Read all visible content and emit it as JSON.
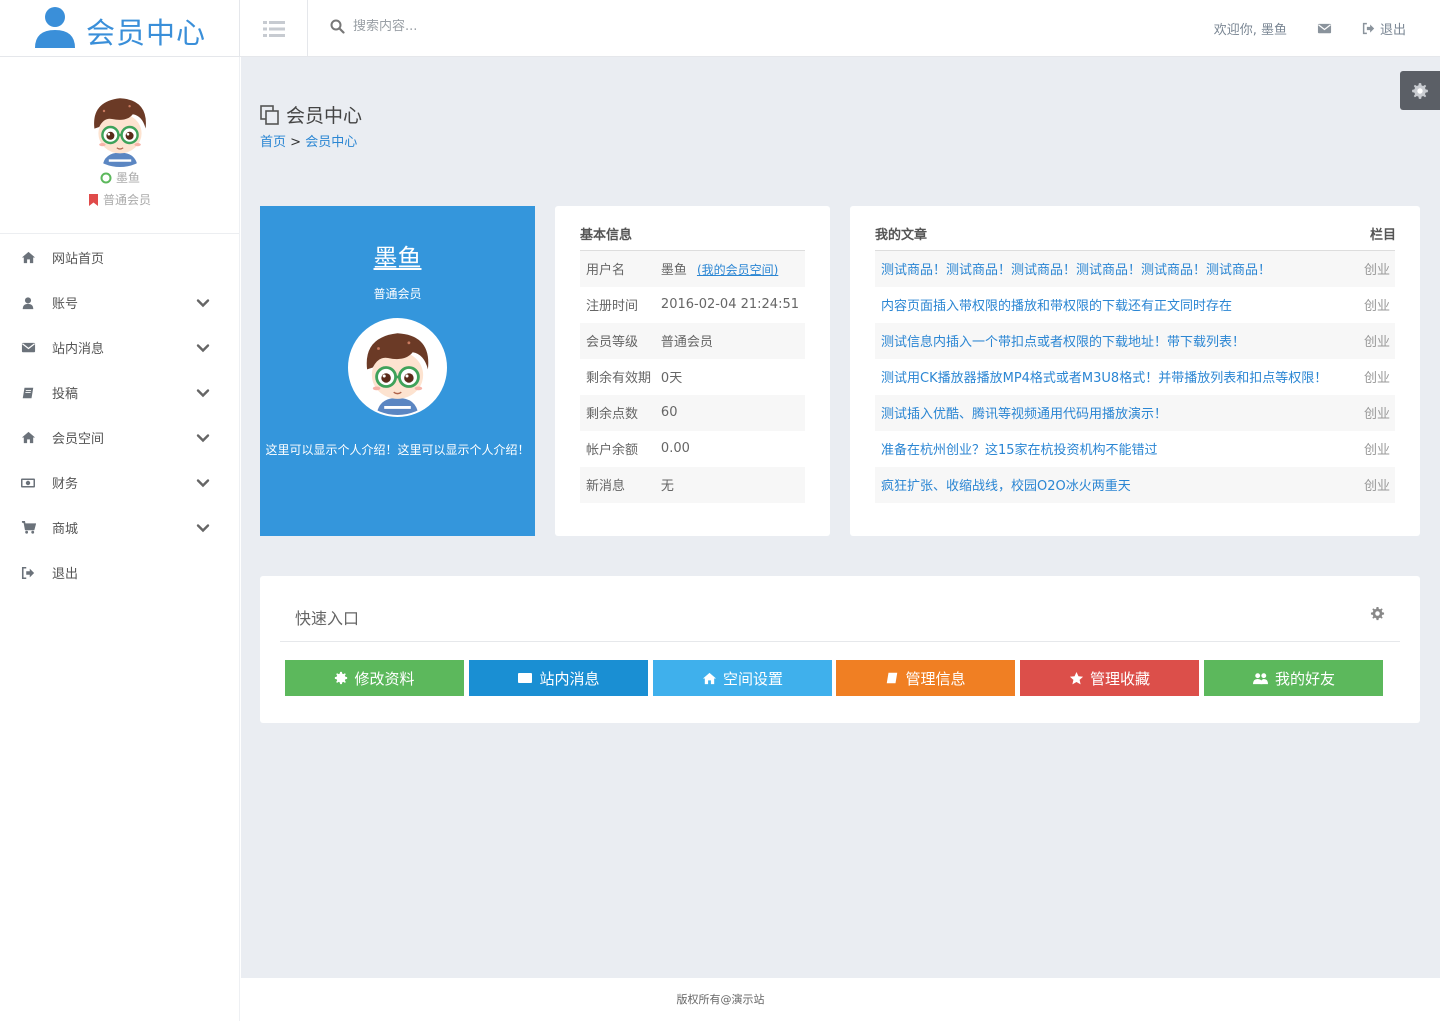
{
  "header": {
    "logo_text": "会员中心",
    "search_placeholder": "搜索内容...",
    "welcome": "欢迎你, 墨鱼",
    "logout": "退出"
  },
  "sidebar": {
    "profile_name": "墨鱼",
    "profile_level": "普通会员",
    "items": [
      {
        "label": "网站首页",
        "icon": "home-icon",
        "expandable": false
      },
      {
        "label": "账号",
        "icon": "user-icon",
        "expandable": true
      },
      {
        "label": "站内消息",
        "icon": "envelope-icon",
        "expandable": true
      },
      {
        "label": "投稿",
        "icon": "book-icon",
        "expandable": true
      },
      {
        "label": "会员空间",
        "icon": "home-icon",
        "expandable": true
      },
      {
        "label": "财务",
        "icon": "money-icon",
        "expandable": true
      },
      {
        "label": "商城",
        "icon": "cart-icon",
        "expandable": true
      },
      {
        "label": "退出",
        "icon": "sign-out-icon",
        "expandable": false
      }
    ]
  },
  "page": {
    "title": "会员中心",
    "breadcrumb_home": "首页",
    "breadcrumb_sep": ">",
    "breadcrumb_current": "会员中心"
  },
  "profile_card": {
    "name": "墨鱼",
    "level": "普通会员",
    "intro": "这里可以显示个人介绍！这里可以显示个人介绍！"
  },
  "basic_info": {
    "title": "基本信息",
    "rows": [
      {
        "key": "用户名",
        "value": "墨鱼",
        "link": "(我的会员空间)"
      },
      {
        "key": "注册时间",
        "value": "2016-02-04 21:24:51"
      },
      {
        "key": "会员等级",
        "value": "普通会员"
      },
      {
        "key": "剩余有效期",
        "value": "0天"
      },
      {
        "key": "剩余点数",
        "value": "60"
      },
      {
        "key": "帐户余额",
        "value": "0.00"
      },
      {
        "key": "新消息",
        "value": "无"
      }
    ]
  },
  "articles": {
    "title": "我的文章",
    "column_label": "栏目",
    "rows": [
      {
        "title": "测试商品！测试商品！测试商品！测试商品！测试商品！测试商品！",
        "category": "创业"
      },
      {
        "title": "内容页面插入带权限的播放和带权限的下载还有正文同时存在",
        "category": "创业"
      },
      {
        "title": "测试信息内插入一个带扣点或者权限的下载地址！带下载列表！",
        "category": "创业"
      },
      {
        "title": "测试用CK播放器播放MP4格式或者M3U8格式！并带播放列表和扣点等权限！",
        "category": "创业"
      },
      {
        "title": "测试插入优酷、腾讯等视频通用代码用播放演示！",
        "category": "创业"
      },
      {
        "title": "准备在杭州创业？这15家在杭投资机构不能错过",
        "category": "创业"
      },
      {
        "title": "疯狂扩张、收缩战线，校园O2O冰火两重天",
        "category": "创业"
      }
    ]
  },
  "quick": {
    "title": "快速入口",
    "buttons": [
      {
        "label": "修改资料",
        "icon": "gear-icon",
        "color": "#5cb85c"
      },
      {
        "label": "站内消息",
        "icon": "envelope-icon",
        "color": "#1a8fd3"
      },
      {
        "label": "空间设置",
        "icon": "home-icon",
        "color": "#3fb0ec"
      },
      {
        "label": "管理信息",
        "icon": "book-icon",
        "color": "#f07f23"
      },
      {
        "label": "管理收藏",
        "icon": "star-icon",
        "color": "#dc4f4a"
      },
      {
        "label": "我的好友",
        "icon": "users-icon",
        "color": "#5cb85c"
      }
    ]
  },
  "footer": {
    "text": "版权所有@演示站"
  },
  "colors": {
    "accent": "#3496dc",
    "link": "#2b86d3",
    "background": "#eaedf2"
  }
}
